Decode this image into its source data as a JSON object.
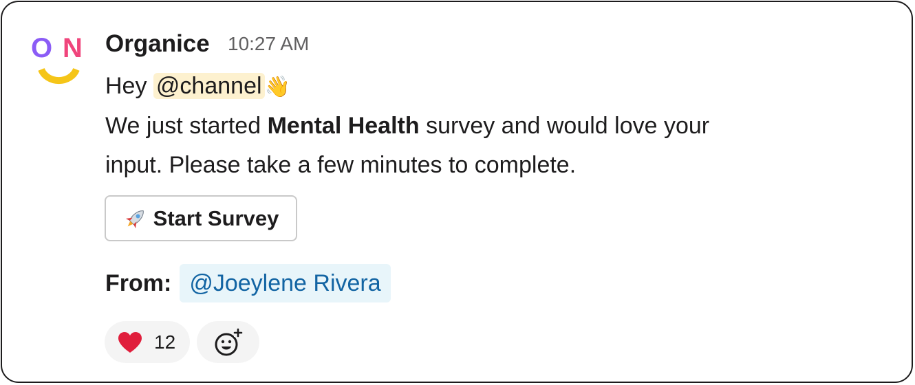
{
  "message": {
    "sender": "Organice",
    "time": "10:27 AM",
    "greeting": "Hey",
    "mention": "@channel",
    "wave_emoji": "👋",
    "text_before_bold": "We just started",
    "bold_text": "Mental Health",
    "text_after_bold": "survey and would love your",
    "line3": "input. Please take a few minutes to complete."
  },
  "avatar": {
    "letters": [
      "O",
      "N"
    ],
    "colors": {
      "o": "#8b5cf6",
      "n": "#f0457c",
      "smile": "#f5c518"
    }
  },
  "button": {
    "label": "Start Survey",
    "icon": "rocket-icon"
  },
  "from": {
    "label": "From:",
    "user": "@Joeylene Rivera"
  },
  "reactions": [
    {
      "icon": "heart-icon",
      "count": "12",
      "color": "#e01e3c"
    }
  ],
  "add_reaction": {
    "icon": "add-reaction-icon"
  }
}
